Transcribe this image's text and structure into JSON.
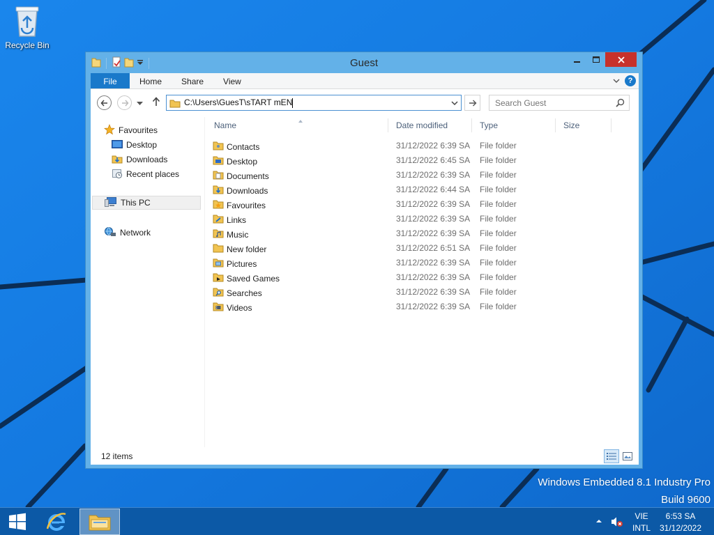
{
  "desktop": {
    "recycle_bin_label": "Recycle Bin",
    "watermark_line1": "Windows Embedded 8.1 Industry Pro",
    "watermark_line2": "Build 9600",
    "background_color": "#1479e0"
  },
  "window": {
    "title": "Guest",
    "accent": "#1979ca",
    "close_color": "#c7312b"
  },
  "ribbon": {
    "tabs": [
      "File",
      "Home",
      "Share",
      "View"
    ],
    "help_label": "?"
  },
  "address": {
    "path": "C:\\Users\\GuesT\\sTART mEN"
  },
  "search": {
    "placeholder": "Search Guest"
  },
  "nav_pane": {
    "favourites": "Favourites",
    "desktop": "Desktop",
    "downloads": "Downloads",
    "recent_places": "Recent places",
    "this_pc": "This PC",
    "network": "Network"
  },
  "columns": {
    "name": "Name",
    "date": "Date modified",
    "type": "Type",
    "size": "Size"
  },
  "files": [
    {
      "name": "Contacts",
      "date": "31/12/2022 6:39 SA",
      "type": "File folder",
      "icon": "contacts-folder-icon"
    },
    {
      "name": "Desktop",
      "date": "31/12/2022 6:45 SA",
      "type": "File folder",
      "icon": "desktop-folder-icon"
    },
    {
      "name": "Documents",
      "date": "31/12/2022 6:39 SA",
      "type": "File folder",
      "icon": "documents-folder-icon"
    },
    {
      "name": "Downloads",
      "date": "31/12/2022 6:44 SA",
      "type": "File folder",
      "icon": "downloads-folder-icon"
    },
    {
      "name": "Favourites",
      "date": "31/12/2022 6:39 SA",
      "type": "File folder",
      "icon": "favourites-folder-icon"
    },
    {
      "name": "Links",
      "date": "31/12/2022 6:39 SA",
      "type": "File folder",
      "icon": "links-folder-icon"
    },
    {
      "name": "Music",
      "date": "31/12/2022 6:39 SA",
      "type": "File folder",
      "icon": "music-folder-icon"
    },
    {
      "name": "New folder",
      "date": "31/12/2022 6:51 SA",
      "type": "File folder",
      "icon": "folder-icon"
    },
    {
      "name": "Pictures",
      "date": "31/12/2022 6:39 SA",
      "type": "File folder",
      "icon": "pictures-folder-icon"
    },
    {
      "name": "Saved Games",
      "date": "31/12/2022 6:39 SA",
      "type": "File folder",
      "icon": "saved-games-folder-icon"
    },
    {
      "name": "Searches",
      "date": "31/12/2022 6:39 SA",
      "type": "File folder",
      "icon": "searches-folder-icon"
    },
    {
      "name": "Videos",
      "date": "31/12/2022 6:39 SA",
      "type": "File folder",
      "icon": "videos-folder-icon"
    }
  ],
  "status": {
    "count": "12 items"
  },
  "taskbar": {
    "lang_top": "VIE",
    "lang_bottom": "INTL",
    "time": "6:53 SA",
    "date": "31/12/2022",
    "color": "#0c59a6"
  }
}
